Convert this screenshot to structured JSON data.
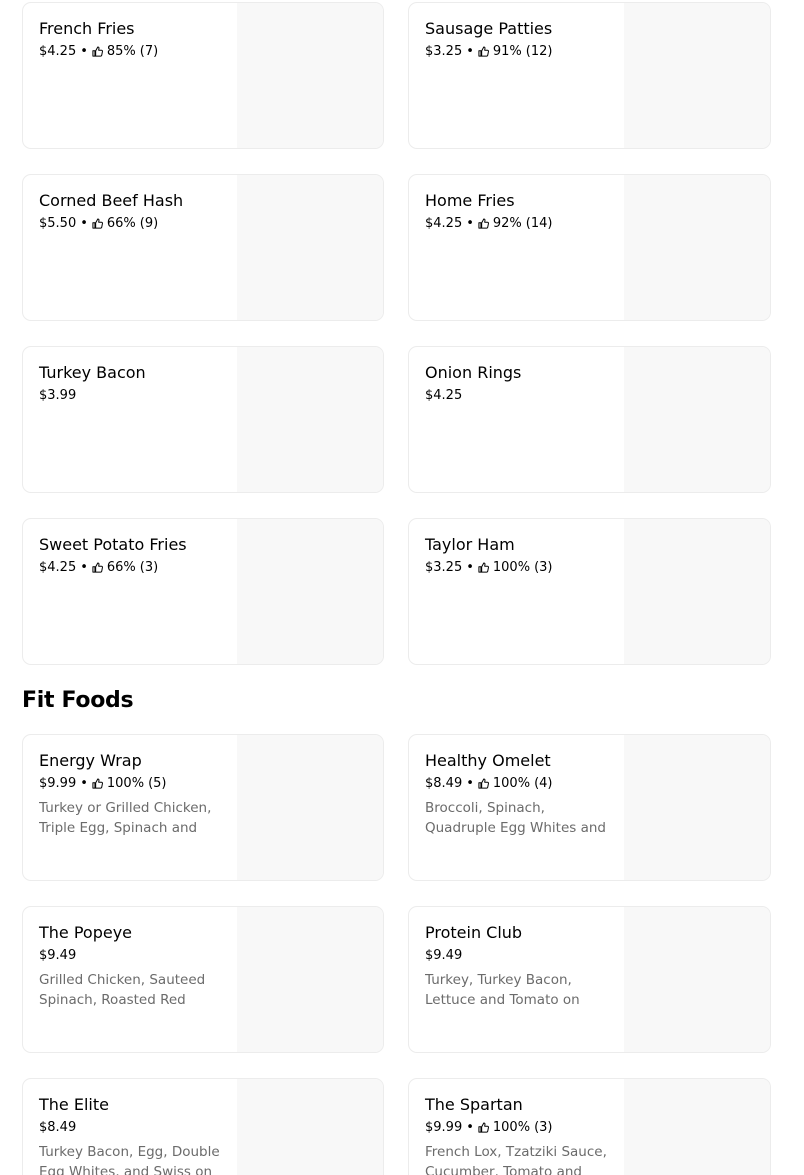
{
  "top_items": [
    {
      "name": "French Fries",
      "price": "$4.25",
      "rating": "85%",
      "count": "(7)",
      "desc": ""
    },
    {
      "name": "Sausage Patties",
      "price": "$3.25",
      "rating": "91%",
      "count": "(12)",
      "desc": ""
    },
    {
      "name": "Corned Beef Hash",
      "price": "$5.50",
      "rating": "66%",
      "count": "(9)",
      "desc": ""
    },
    {
      "name": "Home Fries",
      "price": "$4.25",
      "rating": "92%",
      "count": "(14)",
      "desc": ""
    },
    {
      "name": "Turkey Bacon",
      "price": "$3.99",
      "rating": "",
      "count": "",
      "desc": ""
    },
    {
      "name": "Onion Rings",
      "price": "$4.25",
      "rating": "",
      "count": "",
      "desc": ""
    },
    {
      "name": "Sweet Potato Fries",
      "price": "$4.25",
      "rating": "66%",
      "count": "(3)",
      "desc": ""
    },
    {
      "name": "Taylor Ham",
      "price": "$3.25",
      "rating": "100%",
      "count": "(3)",
      "desc": ""
    }
  ],
  "fit_section": {
    "title": "Fit Foods",
    "items": [
      {
        "name": "Energy Wrap",
        "price": "$9.99",
        "rating": "100%",
        "count": "(5)",
        "desc": "Turkey or Grilled Chicken, Triple Egg, Spinach and"
      },
      {
        "name": "Healthy Omelet",
        "price": "$8.49",
        "rating": "100%",
        "count": "(4)",
        "desc": "Broccoli, Spinach, Quadruple Egg Whites and"
      },
      {
        "name": "The Popeye",
        "price": "$9.49",
        "rating": "",
        "count": "",
        "desc": "Grilled Chicken, Sauteed Spinach, Roasted Red"
      },
      {
        "name": "Protein Club",
        "price": "$9.49",
        "rating": "",
        "count": "",
        "desc": "Turkey, Turkey Bacon, Lettuce and Tomato on"
      },
      {
        "name": "The Elite",
        "price": "$8.49",
        "rating": "",
        "count": "",
        "desc": "Turkey Bacon, Egg, Double Egg Whites, and Swiss on"
      },
      {
        "name": "The Spartan",
        "price": "$9.99",
        "rating": "100%",
        "count": "(3)",
        "desc": "French Lox, Tzatziki Sauce, Cucumber, Tomato and"
      }
    ]
  },
  "separator": "•",
  "icons": {
    "rating": "thumbs-up-icon"
  }
}
